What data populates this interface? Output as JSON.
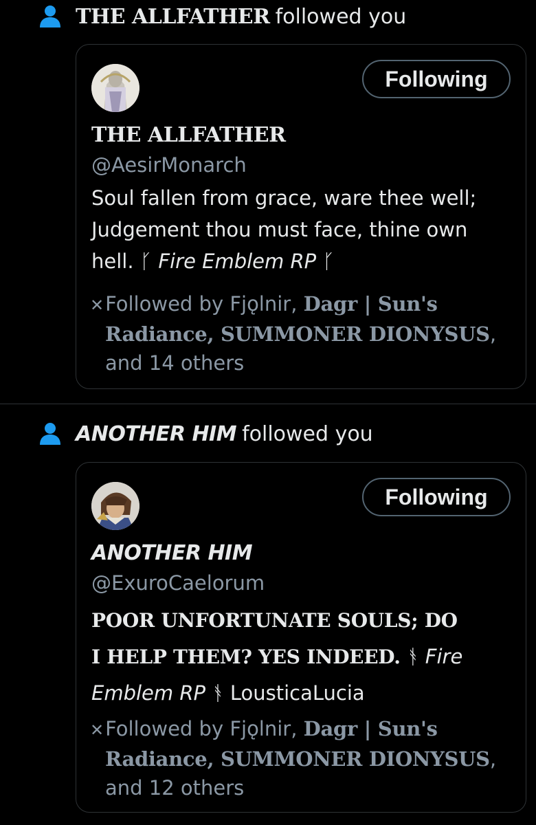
{
  "notifications": [
    {
      "name": "THE ALLFATHER",
      "action": "followed you",
      "card": {
        "follow_label": "Following",
        "display_name": "THE ALLFATHER",
        "handle": "@AesirMonarch",
        "bio_line1": "Soul fallen from grace, ware thee well;",
        "bio_line2": "Judgement thou must face, thine own",
        "bio_line3_plain": "hell. ᚴ ",
        "bio_line3_italic": "Fire Emblem RP",
        "bio_line3_end": " ᚴ",
        "followed_prefix": "Followed by Fjǫlnir, ",
        "followed_name1": "Dagr | Sun's",
        "followed_name1b": "Radiance",
        "followed_sep": ", ",
        "followed_name2": "SUMMONER DIONYSUS",
        "followed_comma": ",",
        "followed_others": "and 14 others"
      }
    },
    {
      "name": "ANOTHER HIM",
      "action": "followed you",
      "card": {
        "follow_label": "Following",
        "display_name": "ANOTHER HIM",
        "handle": "@ExuroCaelorum",
        "bio_line1": "POOR UNFORTUNATE SOULS; DO",
        "bio_line2_serif": "I HELP THEM? YES INDEED. ",
        "bio_line2_rune": "ᚬ ",
        "bio_line2_italic": "Fire",
        "bio_line3_italic": "Emblem RP",
        "bio_line3_rest": " ᚬ LousticaLucia",
        "followed_prefix": "Followed by Fjǫlnir, ",
        "followed_name1": "Dagr | Sun's",
        "followed_name1b": "Radiance",
        "followed_sep": ", ",
        "followed_name2": "SUMMONER DIONYSUS",
        "followed_comma": ",",
        "followed_others": "and 12 others"
      }
    }
  ],
  "colors": {
    "background": "#000000",
    "text_primary": "#e7e9ea",
    "text_secondary": "#8b98a5",
    "accent_icon": "#1d9bf0",
    "border": "#2f3336"
  },
  "icons": {
    "notification_type": "person-icon",
    "mutual_followers": "x-logo-icon"
  }
}
